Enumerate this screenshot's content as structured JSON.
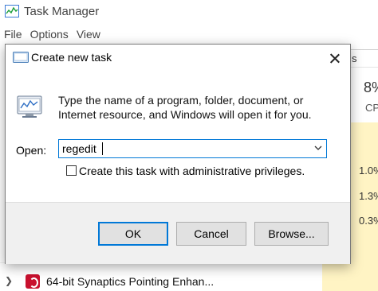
{
  "task_manager": {
    "title": "Task Manager",
    "menu": [
      "File",
      "Options",
      "View"
    ],
    "tab_fragment": "s",
    "cpu_percent": "8%",
    "cpu_label": "CP",
    "cpu_cells": [
      "1.0%",
      "1.3%",
      "0.3%"
    ],
    "row": {
      "label": "64-bit Synaptics Pointing Enhan...",
      "icon": "synaptics-icon"
    }
  },
  "dialog": {
    "title": "Create new task",
    "description": "Type the name of a program, folder, document, or Internet resource, and Windows will open it for you.",
    "open_label": "Open:",
    "open_value": "regedit",
    "admin_checkbox_label": "Create this task with administrative privileges.",
    "admin_checked": false,
    "buttons": {
      "ok": "OK",
      "cancel": "Cancel",
      "browse": "Browse..."
    }
  },
  "colors": {
    "accent": "#0078d7",
    "cpu_column": "#fff4c4",
    "footer": "#f0f0f0"
  }
}
